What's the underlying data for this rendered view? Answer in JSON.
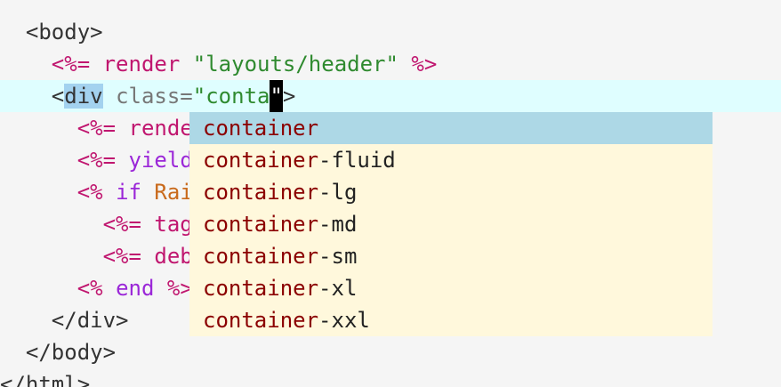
{
  "editor": {
    "lines": {
      "l1": {
        "tag": "<body>"
      },
      "l2": {
        "open": "<%=",
        "method": "render",
        "string": "\"layouts/header\"",
        "close": "%>"
      },
      "l3": {
        "lt": "<",
        "tagname": "div",
        "attr": "class=",
        "string": "\"conta",
        "cursor_char": "\"",
        "gt": ">"
      },
      "l4": {
        "open": "<%=",
        "method": "rende"
      },
      "l5": {
        "open": "<%=",
        "keyword": "yield"
      },
      "l6": {
        "open": "<%",
        "keyword": "if",
        "const": "Rai"
      },
      "l7": {
        "open": "<%=",
        "method": "tag"
      },
      "l8": {
        "open": "<%=",
        "method": "deb"
      },
      "l9": {
        "open": "<%",
        "keyword": "end",
        "close": "%>"
      },
      "l10": {
        "tag": "</div>"
      },
      "l11": {
        "tag": "</body>"
      },
      "l12": {
        "tag": "</html>"
      }
    }
  },
  "completion": {
    "match_prefix": "container",
    "items": [
      {
        "match": "container",
        "rest": ""
      },
      {
        "match": "container",
        "rest": "-fluid"
      },
      {
        "match": "container",
        "rest": "-lg"
      },
      {
        "match": "container",
        "rest": "-md"
      },
      {
        "match": "container",
        "rest": "-sm"
      },
      {
        "match": "container",
        "rest": "-xl"
      },
      {
        "match": "container",
        "rest": "-xxl"
      }
    ],
    "selected_index": 0
  },
  "colors": {
    "background": "#f5f5f5",
    "current_line": "#dffeff",
    "completion_bg": "#fff8dc",
    "completion_selected": "#add8e6",
    "erb_delimiter": "#c0166f",
    "string": "#2f8a2f",
    "keyword": "#9b27d8",
    "constant": "#c96a1c",
    "match": "#8b0000"
  }
}
